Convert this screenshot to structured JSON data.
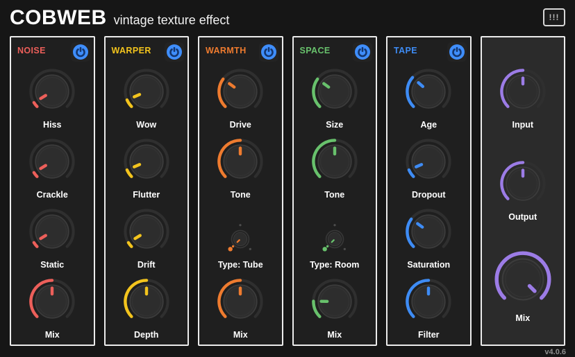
{
  "header": {
    "logo": "COBWEB",
    "subtitle": "vintage texture effect",
    "menu_button": "!!!",
    "version": "v4.0.6"
  },
  "power_icon": "power-icon",
  "power_color": "#3f8efc",
  "power_glyph_color": "#14366e",
  "sections": [
    {
      "name": "NOISE",
      "color": "#ec5f5a",
      "power_on": true,
      "knobs": [
        {
          "label": "Hiss",
          "value": 0.05
        },
        {
          "label": "Crackle",
          "value": 0.05
        },
        {
          "label": "Static",
          "value": 0.05
        },
        {
          "label": "Mix",
          "value": 0.5
        }
      ]
    },
    {
      "name": "WARPER",
      "color": "#f3c41d",
      "power_on": true,
      "knobs": [
        {
          "label": "Wow",
          "value": 0.08
        },
        {
          "label": "Flutter",
          "value": 0.08
        },
        {
          "label": "Drift",
          "value": 0.05
        },
        {
          "label": "Depth",
          "value": 0.5
        }
      ]
    },
    {
      "name": "WARMTH",
      "color": "#ee7b2f",
      "power_on": true,
      "knobs": [
        {
          "label": "Drive",
          "value": 0.3
        },
        {
          "label": "Tone",
          "value": 0.5
        },
        {
          "label": "Type: Tube",
          "value": 0,
          "type": "selector"
        },
        {
          "label": "Mix",
          "value": 0.5
        }
      ]
    },
    {
      "name": "SPACE",
      "color": "#68c16c",
      "power_on": true,
      "knobs": [
        {
          "label": "Size",
          "value": 0.3
        },
        {
          "label": "Tone",
          "value": 0.5
        },
        {
          "label": "Type: Room",
          "value": 0,
          "type": "selector"
        },
        {
          "label": "Mix",
          "value": 0.17
        }
      ]
    },
    {
      "name": "TAPE",
      "color": "#3e8cf5",
      "power_on": true,
      "knobs": [
        {
          "label": "Age",
          "value": 0.32
        },
        {
          "label": "Dropout",
          "value": 0.08
        },
        {
          "label": "Saturation",
          "value": 0.3
        },
        {
          "label": "Filter",
          "value": 0.5
        }
      ]
    }
  ],
  "master": {
    "color": "#9c7ce6",
    "knobs": [
      {
        "label": "Input",
        "value": 0.5
      },
      {
        "label": "Output",
        "value": 0.5
      },
      {
        "label": "Mix",
        "value": 1.0,
        "large": true
      }
    ]
  }
}
